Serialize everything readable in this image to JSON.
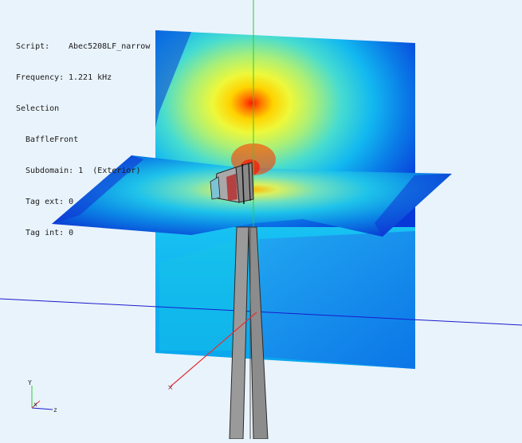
{
  "info": {
    "script_label": "Script:",
    "script_value": "Abec5208LF_narrow",
    "frequency_label": "Frequency:",
    "frequency_value": "1.221 kHz",
    "selection_label": "Selection",
    "element": "BaffleFront",
    "subdomain": "Subdomain: 1  (Exterior)",
    "tag_ext": "Tag ext: 0",
    "tag_int": "Tag int: 0"
  },
  "triad": {
    "x": "x",
    "y": "Y",
    "z": "z"
  },
  "colors": {
    "background": "#e9f3fb",
    "hot": "#ff1a00",
    "cold": "#0033d9",
    "axis_green": "#33cc33",
    "axis_blue": "#1a1acc",
    "axis_red": "#e0303a"
  }
}
